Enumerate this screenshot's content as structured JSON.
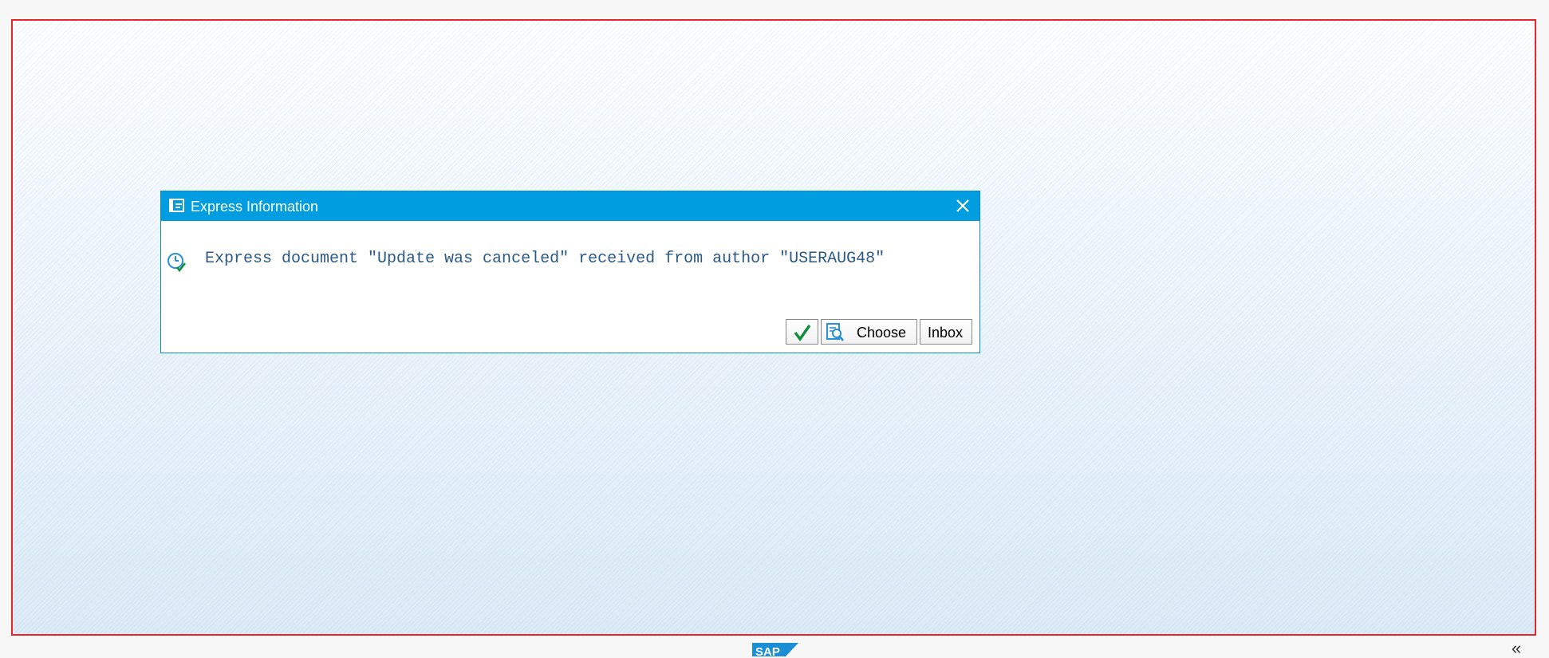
{
  "dialog": {
    "title": "Express Information",
    "title_icon": "popup-window-icon",
    "close_icon": "close-icon",
    "message": "Express document \"Update was canceled\" received from author \"USERAUG48\"",
    "message_icon": "express-document-clock-icon",
    "buttons": {
      "ok_icon": "checkmark-icon",
      "choose_label": "Choose",
      "choose_icon": "choose-document-icon",
      "inbox_label": "Inbox"
    }
  },
  "footer": {
    "logo_text": "SAP",
    "collapse_glyph": "«"
  },
  "colors": {
    "titlebar": "#009de0",
    "message_text": "#2c5a84",
    "workarea_border": "#e8262b",
    "ok_check": "#0f8f3d"
  }
}
